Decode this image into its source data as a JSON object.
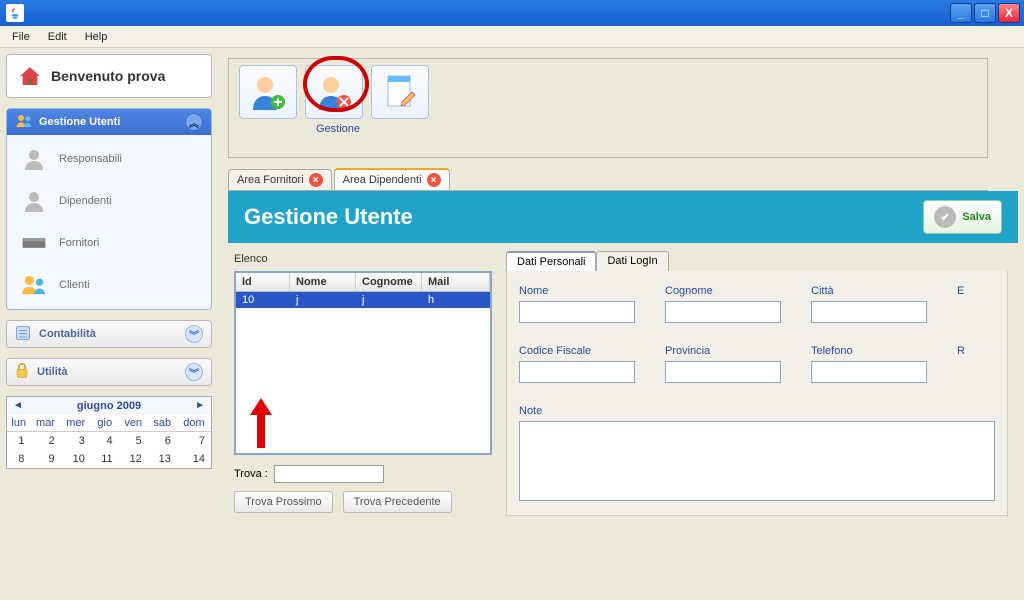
{
  "menubar": {
    "file": "File",
    "edit": "Edit",
    "help": "Help"
  },
  "welcome": "Benvenuto prova",
  "sidebar": {
    "section1": {
      "title": "Gestione Utenti",
      "items": [
        {
          "label": "Responsabili"
        },
        {
          "label": "Dipendenti"
        },
        {
          "label": "Fornitori"
        },
        {
          "label": "Clienti"
        }
      ]
    },
    "section2": {
      "title": "Contabilità"
    },
    "section3": {
      "title": "Utilità"
    }
  },
  "calendar": {
    "title": "giugno 2009",
    "dow": [
      "lun",
      "mar",
      "mer",
      "gio",
      "ven",
      "sab",
      "dom"
    ],
    "rows": [
      [
        "1",
        "2",
        "3",
        "4",
        "5",
        "6",
        "7"
      ],
      [
        "8",
        "9",
        "10",
        "11",
        "12",
        "13",
        "14"
      ]
    ]
  },
  "toolbar": {
    "group_label": "Gestione"
  },
  "tabs": [
    {
      "label": "Area Fornitori"
    },
    {
      "label": "Area Dipendenti"
    }
  ],
  "page": {
    "title": "Gestione Utente",
    "save": "Salva"
  },
  "elenco": {
    "label": "Elenco",
    "cols": {
      "id": "Id",
      "nome": "Nome",
      "cognome": "Cognome",
      "mail": "Mail"
    },
    "rows": [
      {
        "id": "10",
        "nome": "j",
        "cognome": "j",
        "mail": "h"
      }
    ],
    "trova_label": "Trova  :",
    "trova_next": "Trova Prossimo",
    "trova_prev": "Trova Precedente"
  },
  "detail": {
    "tabs": {
      "t1": "Dati Personali",
      "t2": "Dati LogIn"
    },
    "labels": {
      "nome": "Nome",
      "cognome": "Cognome",
      "citta": "Città",
      "extra1": "E",
      "cf": "Codice Fiscale",
      "provincia": "Provincia",
      "telefono": "Telefono",
      "extra2": "R",
      "note": "Note"
    }
  }
}
